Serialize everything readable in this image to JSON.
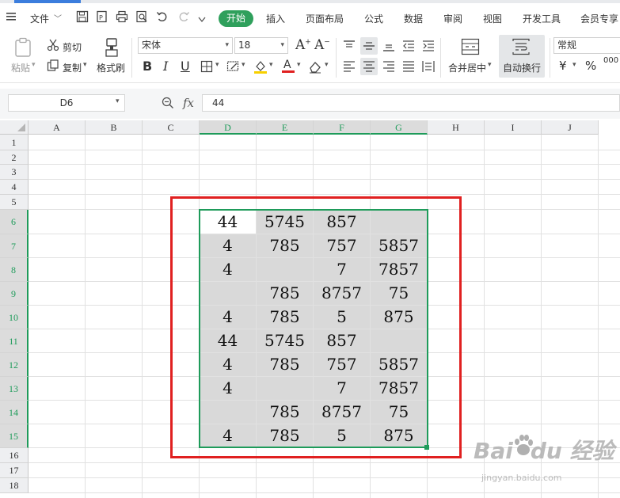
{
  "menubar": {
    "file_label": "文件",
    "tabs": [
      "开始",
      "插入",
      "页面布局",
      "公式",
      "数据",
      "审阅",
      "视图",
      "开发工具",
      "会员专享"
    ]
  },
  "ribbon": {
    "paste_label": "粘贴",
    "cut_label": "剪切",
    "copy_label": "复制",
    "format_painter_label": "格式刷",
    "font_name": "宋体",
    "font_size": "18",
    "bold": "B",
    "italic": "I",
    "underline": "U",
    "merge_label": "合并居中",
    "wrap_label": "自动换行",
    "number_format": "常规",
    "currency_symbol": "¥",
    "percent_symbol": "%",
    "thousands_symbol": "000"
  },
  "formula_bar": {
    "name_box": "D6",
    "fx_label": "fx",
    "formula": "44"
  },
  "grid": {
    "columns": [
      "A",
      "B",
      "C",
      "D",
      "E",
      "F",
      "G",
      "H",
      "I",
      "J"
    ],
    "selected_columns": [
      "D",
      "E",
      "F",
      "G"
    ],
    "rows": [
      "1",
      "2",
      "3",
      "4",
      "5",
      "6",
      "7",
      "8",
      "9",
      "10",
      "11",
      "12",
      "13",
      "14",
      "15",
      "16",
      "17",
      "18"
    ],
    "selected_rows": [
      "6",
      "7",
      "8",
      "9",
      "10",
      "11",
      "12",
      "13",
      "14",
      "15"
    ],
    "active_cell": "D6",
    "data": [
      [
        "44",
        "5745",
        "857",
        ""
      ],
      [
        "4",
        "785",
        "757",
        "5857"
      ],
      [
        "4",
        "",
        "7",
        "7857"
      ],
      [
        "",
        "785",
        "8757",
        "75"
      ],
      [
        "4",
        "785",
        "5",
        "875"
      ],
      [
        "44",
        "5745",
        "857",
        ""
      ],
      [
        "4",
        "785",
        "757",
        "5857"
      ],
      [
        "4",
        "",
        "7",
        "7857"
      ],
      [
        "",
        "785",
        "8757",
        "75"
      ],
      [
        "4",
        "785",
        "5",
        "875"
      ]
    ]
  },
  "colors": {
    "accent_green": "#1e9b5a",
    "highlight_red": "#e02020",
    "cell_shade": "#d9d9d9"
  },
  "watermark": {
    "brand": "Bai du 经验",
    "url": "jingyan.baidu.com"
  }
}
